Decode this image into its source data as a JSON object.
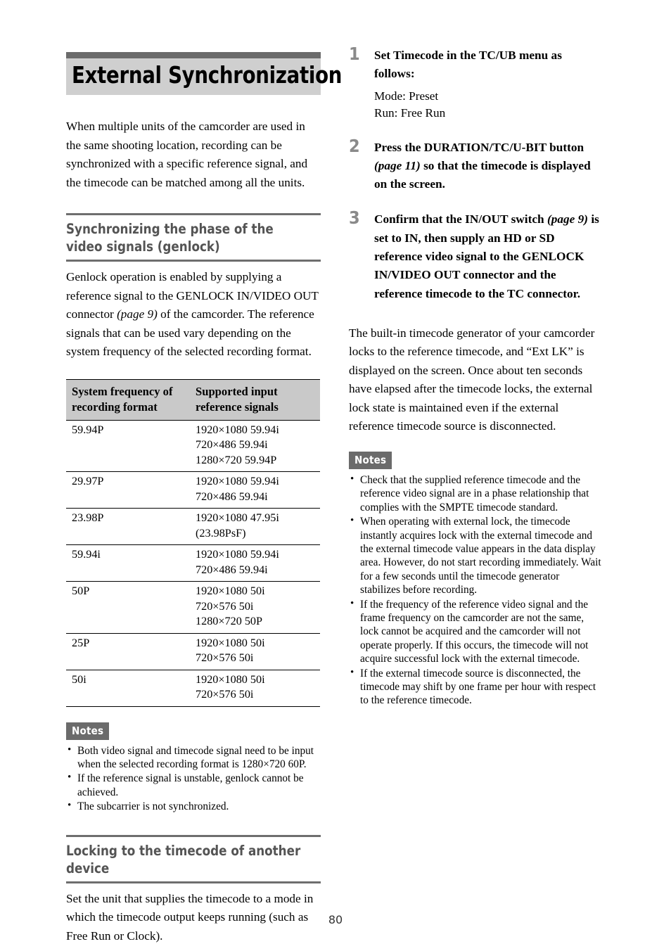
{
  "document": {
    "chapter_title": "External Synchronization",
    "page_number": "80"
  },
  "left_column": {
    "intro": "When multiple units of the camcorder are used in the same shooting location, recording can be synchronized with a specific reference signal, and the timecode can be matched among all the units.",
    "section_genlock": {
      "heading": "Synchronizing the phase of the video signals (genlock)",
      "body_1": "Genlock operation is enabled by supplying a reference signal to the GENLOCK IN/VIDEO OUT connector ",
      "body_ref": "(page 9)",
      "body_2": " of the camcorder. The reference signals that can be used vary depending on the system frequency of the selected recording format.",
      "table": {
        "headers": [
          "System frequency of recording format",
          "Supported input reference signals"
        ],
        "rows": [
          {
            "format": "59.94P",
            "signals": [
              "1920×1080 59.94i",
              "720×486 59.94i",
              "1280×720 59.94P"
            ]
          },
          {
            "format": "29.97P",
            "signals": [
              "1920×1080 59.94i",
              "720×486 59.94i"
            ]
          },
          {
            "format": "23.98P",
            "signals": [
              "1920×1080 47.95i",
              "(23.98PsF)"
            ]
          },
          {
            "format": "59.94i",
            "signals": [
              "1920×1080 59.94i",
              "720×486 59.94i"
            ]
          },
          {
            "format": "50P",
            "signals": [
              "1920×1080 50i",
              "720×576 50i",
              "1280×720 50P"
            ]
          },
          {
            "format": "25P",
            "signals": [
              "1920×1080 50i",
              "720×576 50i"
            ]
          },
          {
            "format": "50i",
            "signals": [
              "1920×1080 50i",
              "720×576 50i"
            ]
          }
        ]
      },
      "notes": {
        "label": "Notes",
        "items": [
          "Both video signal and timecode signal need to be input when the selected recording format is 1280×720 60P.",
          "If the reference signal is unstable, genlock cannot be achieved.",
          "The subcarrier is not synchronized."
        ]
      }
    },
    "section_locking": {
      "heading": "Locking to the timecode of another device",
      "body": "Set the unit that supplies the timecode to a mode in which the timecode output keeps running (such as Free Run or Clock)."
    }
  },
  "right_column": {
    "steps": [
      {
        "number": "1",
        "title": "Set Timecode in the TC/UB menu as follows:",
        "sub_lines": [
          "Mode: Preset",
          "Run: Free Run"
        ]
      },
      {
        "number": "2",
        "title_1": "Press the DURATION/TC/U-BIT button ",
        "title_ref": "(page 11)",
        "title_2": " so that the timecode is displayed on the screen."
      },
      {
        "number": "3",
        "title_1": "Confirm that the IN/OUT switch ",
        "title_ref": "(page 9)",
        "title_2": " is set to IN, then supply an HD or SD reference video signal to the GENLOCK IN/VIDEO OUT connector and the reference timecode to the TC connector."
      }
    ],
    "after_steps": "The built-in timecode generator of your camcorder locks to the reference timecode, and “Ext LK” is displayed on the screen. Once about ten seconds have elapsed after the timecode locks, the external lock state is maintained even if the external reference timecode source is disconnected.",
    "notes": {
      "label": "Notes",
      "items": [
        "Check that the supplied reference timecode and the reference video signal are in a phase relationship that complies with the SMPTE timecode standard.",
        "When operating with external lock, the timecode instantly acquires lock with the external timecode and the external timecode value appears in the data display area. However, do not start recording immediately. Wait for a few seconds until the timecode generator stabilizes before recording.",
        "If the frequency of the reference video signal and the frame frequency on the camcorder are not the same, lock cannot be acquired and the camcorder will not operate properly. If this occurs, the timecode will not acquire successful lock with the external timecode.",
        "If the external timecode source is disconnected, the timecode may shift by one frame per hour with respect to the reference timecode."
      ]
    }
  }
}
